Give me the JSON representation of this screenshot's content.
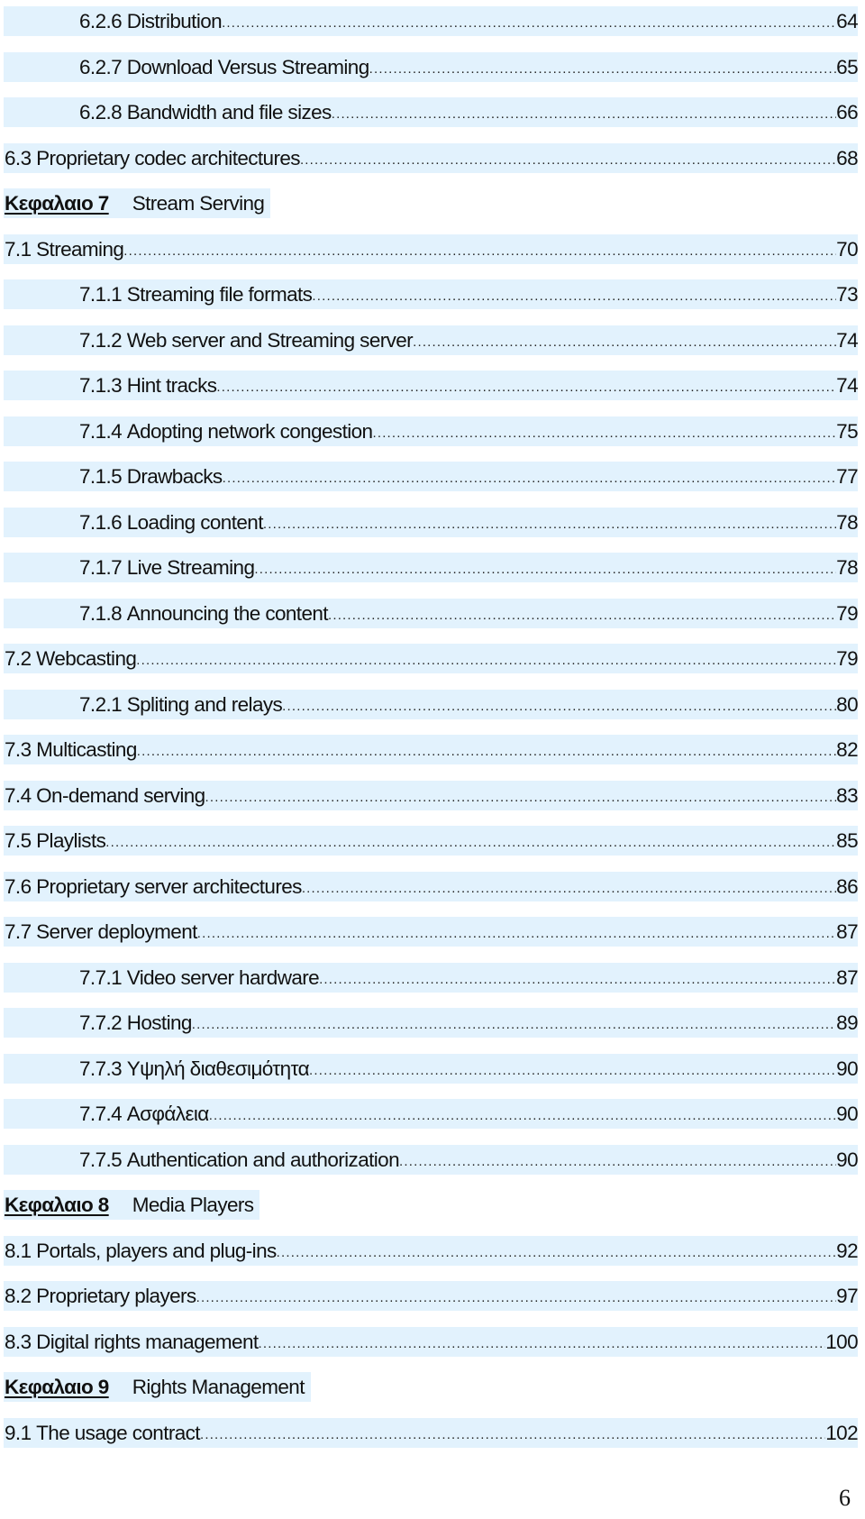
{
  "toc": {
    "rows": [
      {
        "type": "entry",
        "level": 2,
        "number": "6.2.6",
        "title": "Distribution",
        "page": "64"
      },
      {
        "type": "entry",
        "level": 2,
        "number": "6.2.7",
        "title": "Download Versus Streaming",
        "page": "65"
      },
      {
        "type": "entry",
        "level": 2,
        "number": "6.2.8",
        "title": "Bandwidth and file sizes",
        "page": "66"
      },
      {
        "type": "entry",
        "level": 1,
        "number": "6.3",
        "title": "Proprietary codec architectures",
        "page": "68"
      },
      {
        "type": "chapter",
        "label": "Κεφαλαιο 7",
        "title": "Stream Serving"
      },
      {
        "type": "entry",
        "level": 1,
        "number": "7.1",
        "title": "Streaming ",
        "page": "70"
      },
      {
        "type": "entry",
        "level": 2,
        "number": "7.1.1",
        "title": "Streaming file formats",
        "page": "73"
      },
      {
        "type": "entry",
        "level": 2,
        "number": "7.1.2",
        "title": "Web server and Streaming server",
        "page": "74"
      },
      {
        "type": "entry",
        "level": 2,
        "number": "7.1.3",
        "title": "Hint tracks",
        "page": "74"
      },
      {
        "type": "entry",
        "level": 2,
        "number": "7.1.4",
        "title": "Adopting network congestion",
        "page": "75"
      },
      {
        "type": "entry",
        "level": 2,
        "number": "7.1.5",
        "title": "Drawbacks",
        "page": "77"
      },
      {
        "type": "entry",
        "level": 2,
        "number": "7.1.6",
        "title": "Loading content",
        "page": "78"
      },
      {
        "type": "entry",
        "level": 2,
        "number": "7.1.7",
        "title": "Live Streaming",
        "page": "78"
      },
      {
        "type": "entry",
        "level": 2,
        "number": "7.1.8",
        "title": "Announcing the content",
        "page": "79"
      },
      {
        "type": "entry",
        "level": 1,
        "number": "7.2",
        "title": "Webcasting",
        "page": "79"
      },
      {
        "type": "entry",
        "level": 2,
        "number": "7.2.1",
        "title": "Spliting and relays",
        "page": "80"
      },
      {
        "type": "entry",
        "level": 1,
        "number": "7.3",
        "title": "Multicasting",
        "page": "82"
      },
      {
        "type": "entry",
        "level": 1,
        "number": "7.4",
        "title": "On-demand serving",
        "page": "83"
      },
      {
        "type": "entry",
        "level": 1,
        "number": "7.5",
        "title": "Playlists",
        "page": "85"
      },
      {
        "type": "entry",
        "level": 1,
        "number": "7.6",
        "title": "Proprietary server architectures",
        "page": "86"
      },
      {
        "type": "entry",
        "level": 1,
        "number": "7.7",
        "title": "Server deployment",
        "page": "87"
      },
      {
        "type": "entry",
        "level": 2,
        "number": "7.7.1",
        "title": "Video server hardware",
        "page": "87"
      },
      {
        "type": "entry",
        "level": 2,
        "number": "7.7.2",
        "title": "Hosting",
        "page": "89"
      },
      {
        "type": "entry",
        "level": 2,
        "number": "7.7.3",
        "title": "Υψηλή διαθεσιμότητα",
        "page": "90"
      },
      {
        "type": "entry",
        "level": 2,
        "number": "7.7.4",
        "title": "Ασφάλεια",
        "page": "90"
      },
      {
        "type": "entry",
        "level": 2,
        "number": "7.7.5",
        "title": "Authentication and authorization",
        "page": "90"
      },
      {
        "type": "chapter",
        "label": "Κεφαλαιο 8",
        "title": "Media Players"
      },
      {
        "type": "entry",
        "level": 1,
        "number": "8.1",
        "title": "Portals, players and plug-ins",
        "page": "92"
      },
      {
        "type": "entry",
        "level": 1,
        "number": "8.2",
        "title": "Proprietary players",
        "page": "97"
      },
      {
        "type": "entry",
        "level": 1,
        "number": "8.3",
        "title": "Digital rights management",
        "page": "100"
      },
      {
        "type": "chapter",
        "label": "Κεφαλαιο 9",
        "title": "Rights Management"
      },
      {
        "type": "entry",
        "level": 1,
        "number": "9.1",
        "title": "The usage contract",
        "page": "102"
      }
    ]
  },
  "footer": {
    "page_number": "6"
  },
  "colors": {
    "highlight": "#e2f2fd",
    "text": "#111111"
  }
}
